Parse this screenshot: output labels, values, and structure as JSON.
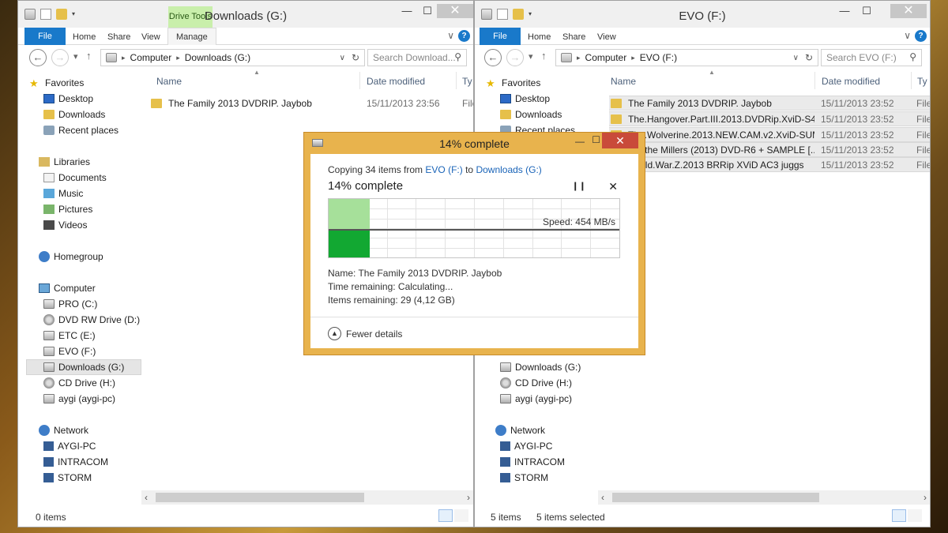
{
  "left": {
    "title": "Downloads (G:)",
    "drive_tools": "Drive Tools",
    "tabs": {
      "file": "File",
      "home": "Home",
      "share": "Share",
      "view": "View",
      "manage": "Manage"
    },
    "address": {
      "root": "Computer",
      "current": "Downloads (G:)"
    },
    "search_placeholder": "Search Download...",
    "columns": {
      "name": "Name",
      "date": "Date modified",
      "type": "Ty"
    },
    "files": [
      {
        "name": "The Family 2013 DVDRIP. Jaybob",
        "date": "15/11/2013 23:56",
        "type": "File"
      }
    ],
    "status": {
      "count": "0 items",
      "selected": ""
    }
  },
  "right": {
    "title": "EVO (F:)",
    "tabs": {
      "file": "File",
      "home": "Home",
      "share": "Share",
      "view": "View"
    },
    "address": {
      "root": "Computer",
      "current": "EVO (F:)"
    },
    "search_placeholder": "Search EVO (F:)",
    "columns": {
      "name": "Name",
      "date": "Date modified",
      "type": "Ty"
    },
    "files": [
      {
        "name": "The Family 2013 DVDRIP. Jaybob",
        "date": "15/11/2013 23:52",
        "type": "File"
      },
      {
        "name": "The.Hangover.Part.III.2013.DVDRip.XviD-S4A",
        "date": "15/11/2013 23:52",
        "type": "File"
      },
      {
        "name": "The.Wolverine.2013.NEW.CAM.v2.XviD-SUM...",
        "date": "15/11/2013 23:52",
        "type": "File"
      },
      {
        "name": "We the Millers (2013) DVD-R6 + SAMPLE [...",
        "date": "15/11/2013 23:52",
        "type": "File"
      },
      {
        "name": "World.War.Z.2013 BRRip XViD AC3 juggs",
        "date": "15/11/2013 23:52",
        "type": "File"
      }
    ],
    "status": {
      "count": "5 items",
      "selected": "5 items selected"
    }
  },
  "nav": {
    "favorites": "Favorites",
    "desktop": "Desktop",
    "downloads": "Downloads",
    "recent": "Recent places",
    "libraries": "Libraries",
    "documents": "Documents",
    "music": "Music",
    "pictures": "Pictures",
    "videos": "Videos",
    "homegroup": "Homegroup",
    "computer": "Computer",
    "pro": "PRO (C:)",
    "dvd": "DVD RW Drive (D:)",
    "etc": "ETC (E:)",
    "evo": "EVO (F:)",
    "dl_drive": "Downloads (G:)",
    "cd": "CD Drive (H:)",
    "aygi": "aygi (aygi-pc)",
    "network": "Network",
    "aygipc": "AYGI-PC",
    "intracom": "INTRACOM",
    "storm": "STORM"
  },
  "dialog": {
    "title": "14% complete",
    "copy_prefix": "Copying 34 items from",
    "from": "EVO (F:)",
    "to_word": "to",
    "to": "Downloads (G:)",
    "progress_text": "14% complete",
    "progress_fraction": 0.14,
    "speed": "Speed: 454 MB/s",
    "name_line": "Name:  The Family 2013 DVDRIP. Jaybob",
    "time_line": "Time remaining:  Calculating...",
    "items_line": "Items remaining:  29 (4,12 GB)",
    "fewer": "Fewer details"
  },
  "colors": {
    "accent": "#1979ca",
    "dialog_frame": "#e8b34d",
    "progress_light": "#a6e09a",
    "progress_dark": "#12a832",
    "close_red": "#c94a3a"
  }
}
